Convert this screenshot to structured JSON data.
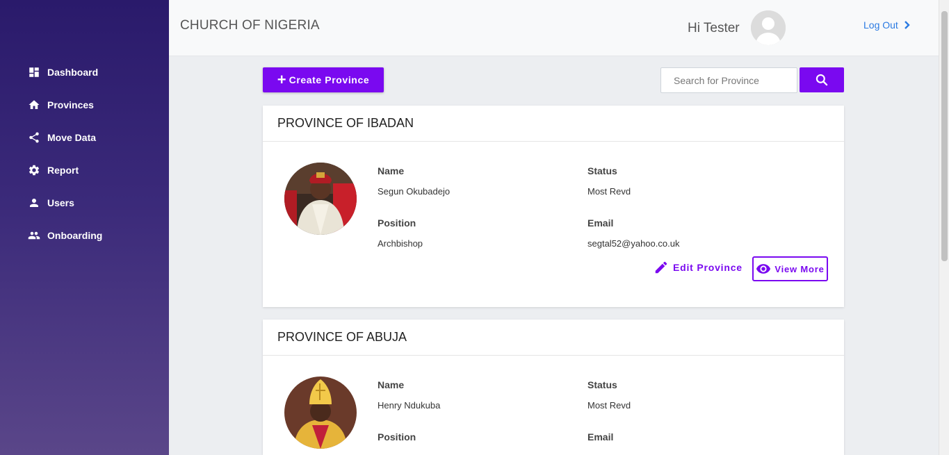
{
  "app": {
    "brand": "CHURCH OF NIGERIA"
  },
  "user": {
    "greeting": "Hi Tester",
    "logout_label": "Log Out"
  },
  "sidebar": {
    "items": [
      {
        "label": "Dashboard",
        "icon": "dashboard-icon"
      },
      {
        "label": "Provinces",
        "icon": "home-icon"
      },
      {
        "label": "Move Data",
        "icon": "share-icon"
      },
      {
        "label": "Report",
        "icon": "gear-icon"
      },
      {
        "label": "Users",
        "icon": "user-icon"
      },
      {
        "label": "Onboarding",
        "icon": "group-icon"
      }
    ]
  },
  "toolbar": {
    "create_label": "Create Province",
    "search_placeholder": "Search for Province"
  },
  "labels": {
    "name": "Name",
    "status": "Status",
    "position": "Position",
    "email": "Email"
  },
  "actions": {
    "edit_label": "Edit Province",
    "view_label": "View More"
  },
  "provinces": [
    {
      "title": "PROVINCE OF IBADAN",
      "name": "Segun Okubadejo",
      "status": "Most Revd",
      "position": "Archbishop",
      "email": "segtal52@yahoo.co.uk"
    },
    {
      "title": "PROVINCE OF ABUJA",
      "name": "Henry Ndukuba",
      "status": "Most Revd",
      "position": "",
      "email": ""
    }
  ],
  "colors": {
    "accent": "#7a09f0",
    "link": "#2a7ae2",
    "sidebar_top": "#2a1a6b",
    "sidebar_bottom": "#5a4689"
  }
}
